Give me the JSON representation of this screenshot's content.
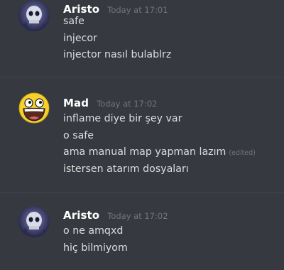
{
  "messages": [
    {
      "username": "Aristo",
      "timestamp": "Today at 17:01",
      "avatar": "skull-avatar",
      "lines": [
        "safe",
        "injecor",
        "injector nasıl bulablrz"
      ]
    },
    {
      "username": "Mad",
      "timestamp": "Today at 17:02",
      "avatar": "awesome-face-avatar",
      "lines": [
        "inflame diye bir şey var",
        "o safe",
        "ama manual map yapman lazım",
        "istersen atarım dosyaları"
      ],
      "edited_label": "(edited)"
    },
    {
      "username": "Aristo",
      "timestamp": "Today at 17:02",
      "avatar": "skull-avatar",
      "lines": [
        "o ne amqxd",
        "hiç bilmiyom"
      ]
    }
  ],
  "colors": {
    "background": "#36393f",
    "username": "#ffffff",
    "message_text": "#dcddde",
    "timestamp": "#72767d"
  }
}
